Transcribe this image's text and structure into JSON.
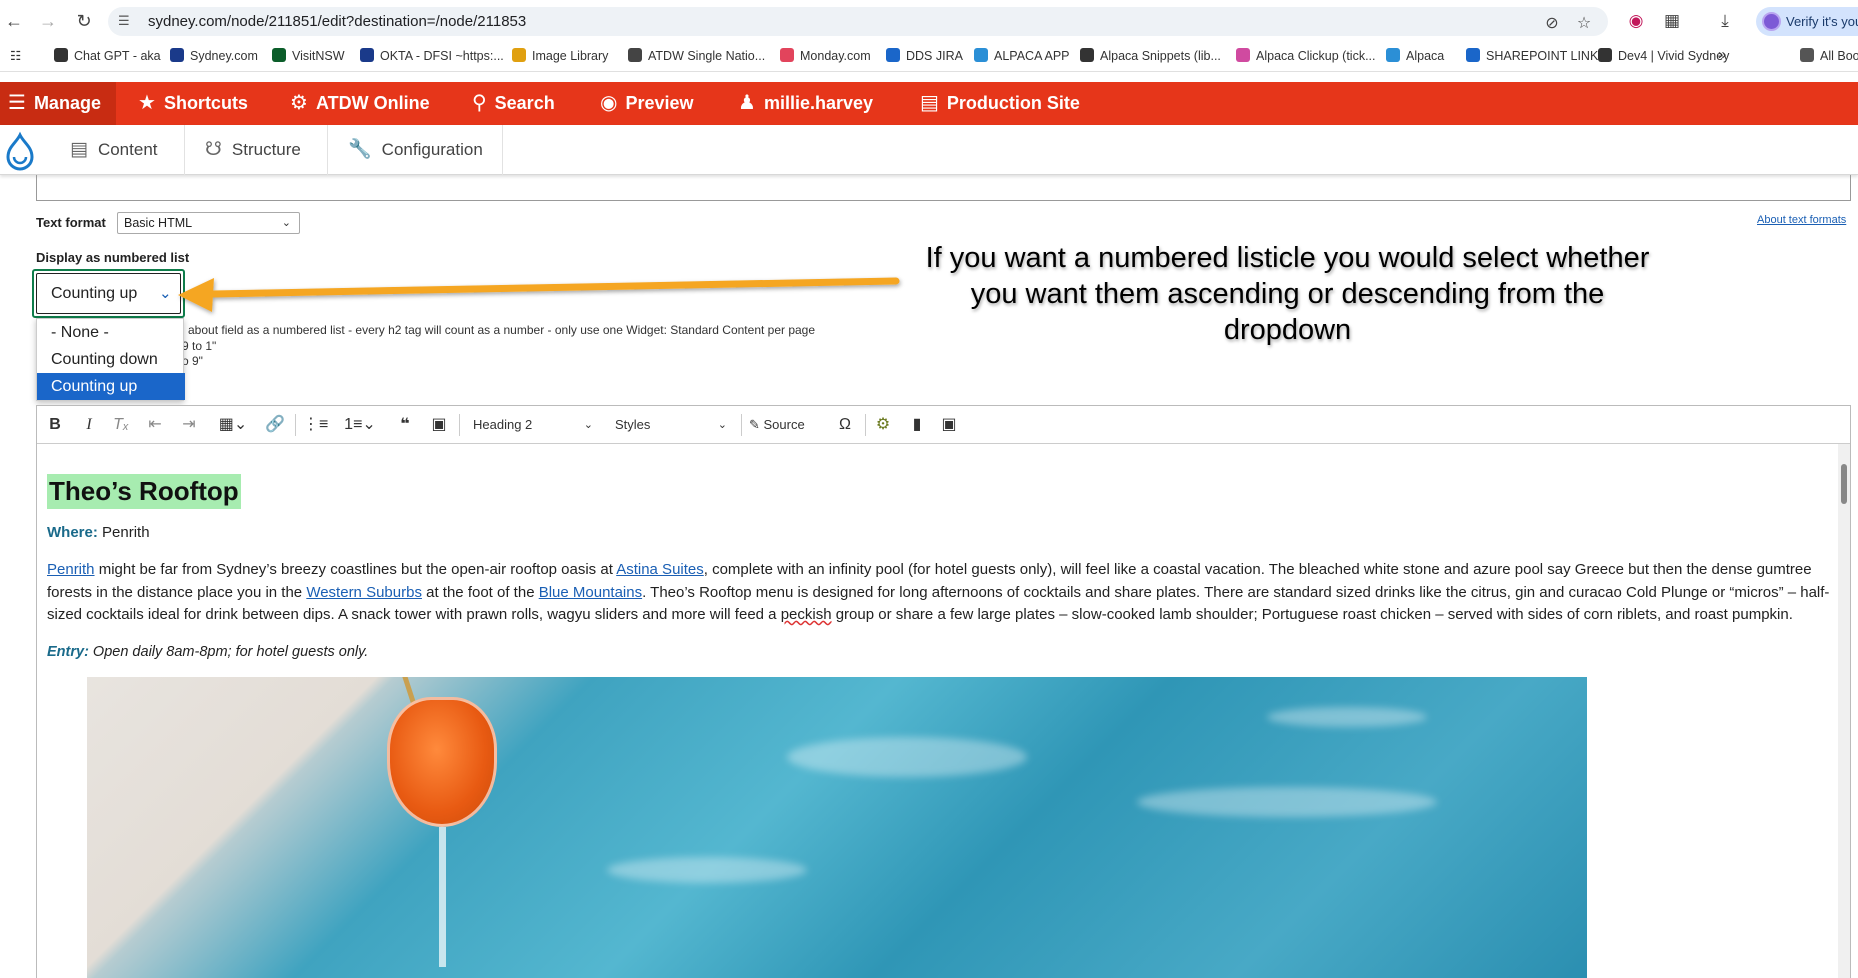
{
  "browser": {
    "url": "sydney.com/node/211851/edit?destination=/node/211853",
    "verify_label": "Verify it's you"
  },
  "bookmarks": [
    {
      "label": "Chat GPT - aka",
      "color": "#333333"
    },
    {
      "label": "Sydney.com",
      "color": "#1a3a8a"
    },
    {
      "label": "VisitNSW",
      "color": "#0b5d2a"
    },
    {
      "label": "OKTA - DFSI ~https:...",
      "color": "#1a3a8a"
    },
    {
      "label": "Image Library",
      "color": "#e0a010"
    },
    {
      "label": "ATDW Single Natio...",
      "color": "#444444"
    },
    {
      "label": "Monday.com",
      "color": "#e2445c"
    },
    {
      "label": "DDS JIRA",
      "color": "#1a66c9"
    },
    {
      "label": "ALPACA APP",
      "color": "#2b8fd6"
    },
    {
      "label": "Alpaca Snippets (lib...",
      "color": "#333333"
    },
    {
      "label": "Alpaca Clickup (tick...",
      "color": "#d04aa0"
    },
    {
      "label": "Alpaca",
      "color": "#2b8fd6"
    },
    {
      "label": "SHAREPOINT LINK",
      "color": "#1a66c9"
    },
    {
      "label": "Dev4 | Vivid Sydney",
      "color": "#333333"
    },
    {
      "label": "All Boo",
      "color": "#555555"
    }
  ],
  "manage_bar": {
    "manage": "Manage",
    "shortcuts": "Shortcuts",
    "atdw": "ATDW Online",
    "search": "Search",
    "preview": "Preview",
    "user": "millie.harvey",
    "production": "Production Site"
  },
  "tray": {
    "content": "Content",
    "structure": "Structure",
    "configuration": "Configuration"
  },
  "form": {
    "text_format_label": "Text format",
    "text_format_value": "Basic HTML",
    "about_text_formats": "About text formats",
    "numbered_list_label": "Display as numbered list",
    "numbered_list_value": "Counting up",
    "description_line1": "about field as a numbered list - every h2 tag will count as a number - only use one Widget: Standard Content per page",
    "description_line2": "9 to 1\"",
    "description_line3": "o 9\"",
    "options": [
      "- None -",
      "Counting down",
      "Counting up"
    ],
    "selected_option": "Counting up"
  },
  "annotation": {
    "text": "If you want a numbered listicle you would select whether you want them ascending or descending from the dropdown",
    "arrow_color": "#f5a623"
  },
  "editor": {
    "heading_dropdown": "Heading 2",
    "styles_dropdown": "Styles",
    "source_label": "Source",
    "heading": "Theo’s Rooftop",
    "where_label": "Where:",
    "where_value": " Penrith",
    "para_link1": "Penrith",
    "para_t1": " might be far from Sydney’s breezy coastlines but the open-air rooftop oasis at ",
    "para_link2": "Astina Suites",
    "para_t2": ", complete with an infinity pool (for hotel guests only), will feel like a coastal vacation. The bleached white stone and azure pool say Greece but then the dense gumtree forests in the distance place you in the ",
    "para_link3": "Western Suburbs",
    "para_t3": " at the foot of the ",
    "para_link4": "Blue Mountains",
    "para_t4": ". Theo’s Rooftop menu is designed for long afternoons of cocktails and share plates. There are standard sized drinks like the citrus, gin and curacao Cold Plunge or “micros” – half-sized cocktails ideal for drink between dips. A snack tower with prawn rolls, wagyu sliders and more will feed a ",
    "para_sq": "peckish",
    "para_t5": " group or share a few large plates – slow-cooked lamb shoulder; Portuguese roast chicken – served with sides of corn riblets, and roast pumpkin.",
    "entry_label": "Entry:",
    "entry_value": " Open daily 8am-8pm; for hotel guests only."
  }
}
